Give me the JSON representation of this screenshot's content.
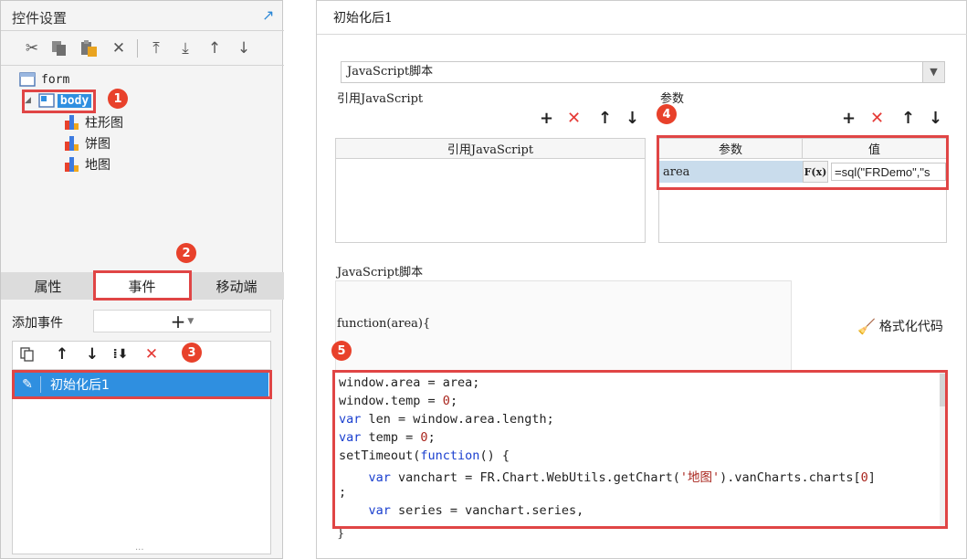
{
  "left_panel": {
    "title": "控件设置",
    "tree": {
      "root": "form",
      "body": "body",
      "children": [
        "柱形图",
        "饼图",
        "地图"
      ]
    },
    "tabs": [
      "属性",
      "事件",
      "移动端"
    ],
    "add_event_label": "添加事件",
    "add_event_button": "+",
    "events": [
      "初始化后1"
    ],
    "resize_grip": "···"
  },
  "right_panel": {
    "title": "初始化后1",
    "script_type": "JavaScript脚本",
    "ref_js_section": "引用JavaScript",
    "ref_js_column": "引用JavaScript",
    "params_section": "参数",
    "params_columns": [
      "参数",
      "值"
    ],
    "params_rows": [
      {
        "name": "area",
        "fx": "F(x)",
        "value": "=sql(\"FRDemo\",\"s"
      }
    ],
    "script_section": "JavaScript脚本",
    "function_signature": "function(area){",
    "format_button": "格式化代码",
    "closing_brace": "}",
    "code_lines": [
      "window.area = area;",
      "window.temp = 0;",
      "var len = window.area.length;",
      "var temp = 0;",
      "setTimeout(function() {",
      "    var vanchart = FR.Chart.WebUtils.getChart('地图').vanCharts.charts[0]",
      ";",
      "    var series = vanchart.series,"
    ]
  },
  "badges": [
    "1",
    "2",
    "3",
    "4",
    "5"
  ],
  "colors": {
    "annotation_red": "#e04545",
    "selection_blue": "#2f8fe0",
    "param_row_blue": "#c9dcec",
    "delete_red": "#e53935",
    "keyword_blue": "#1a3fcf"
  },
  "icons": {
    "toolbar": [
      "cut-icon",
      "copy-icon",
      "paste-icon",
      "delete-icon",
      "move-top-icon",
      "move-bottom-icon",
      "move-up-icon",
      "move-down-icon"
    ],
    "event_toolbar": [
      "copy-icon",
      "move-up-icon",
      "move-down-icon",
      "sort-icon",
      "delete-icon"
    ]
  }
}
